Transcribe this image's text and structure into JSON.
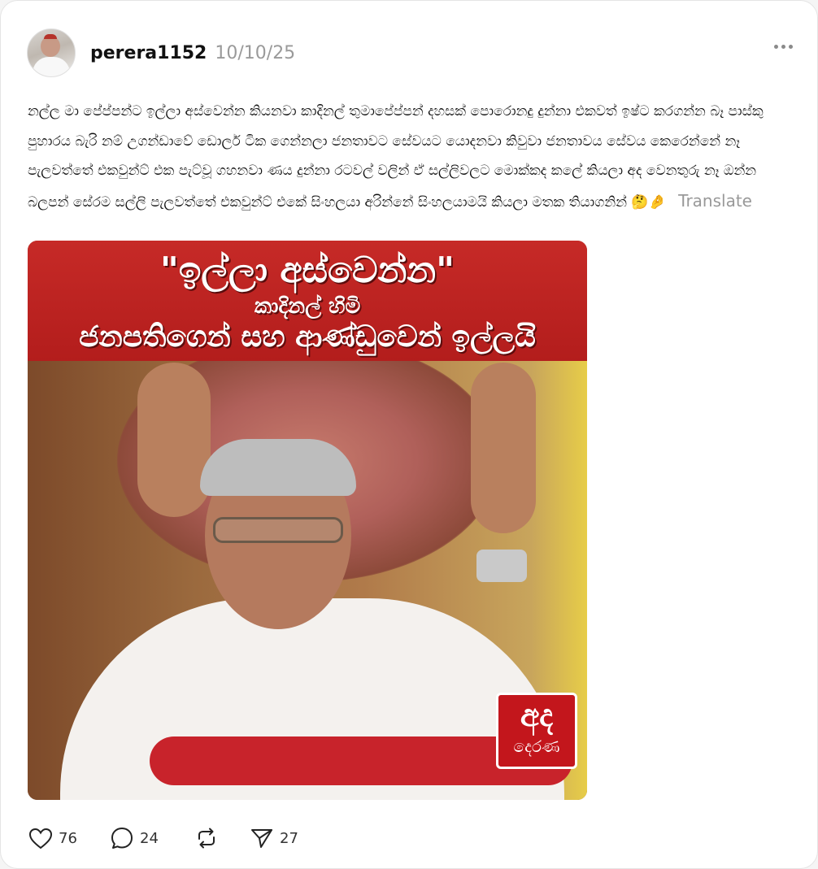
{
  "post": {
    "author": {
      "username": "perera1152",
      "date": "10/10/25",
      "avatar_icon": "profile-photo"
    },
    "more_icon": "more-horizontal-icon",
    "text": "නල්ල මා පේප්පන්ට ඉල්ලා අස්වෙන්න කියනවා කාදිනල් තුමාපේප්පන් දහසක් පොරොනදු දුන්නා එකවත් ඉෂ්ට කරගන්න බෑ පාස්කු පුහාරය බැරි නම් උගන්ඩාවේ ඩොලර් ටික ගෙන්නලා ජනතාවට සේවයට යොදනවා කිවුවා ජනතාවය සේවය කෙරෙන්නේ නෑ පැලවත්තේ එකවුන්ට් එක පැට්වූ ගහනවා ණය දුන්නා රටවල් වලින් ඒ සල්ලිවලට මොක්කද කලේ කියලා අද වෙනතුරු නෑ ඔන්න බලපන් සේරම සල්ලි පැලවත්තේ එකවුන්ට් එකේ සිංහලයා අරින්නේ සිංහලයාමයි කියලා මතක තියාගනින්",
    "emojis": "🤔🤌",
    "translate_label": "Translate",
    "image": {
      "headline": "\"ඉල්ලා අස්වෙන්න\"",
      "subheadline": "කාදිනල් හිමි",
      "subheadline2": "ජනපතිගෙන් සහ ආණ්ඩුවෙන් ඉල්ලයි",
      "logo_top": "අද",
      "logo_bottom": "දෙරණ"
    },
    "actions": {
      "likes": "76",
      "replies": "24",
      "shares": "27",
      "like_icon": "heart-icon",
      "reply_icon": "comment-icon",
      "repost_icon": "repost-icon",
      "share_icon": "send-icon"
    }
  }
}
